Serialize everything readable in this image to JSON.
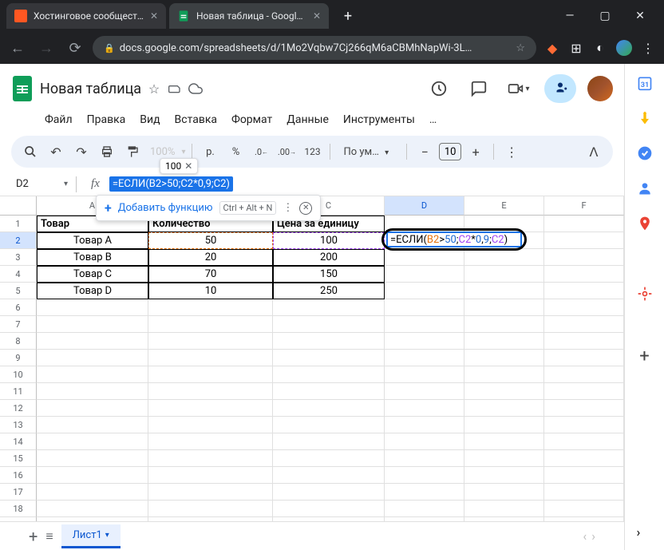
{
  "browser": {
    "tabs": [
      {
        "favicon_color": "#ff0000",
        "title": "Хостинговое сообщество «Tim"
      },
      {
        "favicon_color": "#0f9d58",
        "title": "Новая таблица - Google Табли"
      }
    ],
    "url": "docs.google.com/spreadsheets/d/1Mo2Vqbw7Cj266qM6aCBMhNapWi-3L…"
  },
  "doc": {
    "title": "Новая таблица",
    "menus": [
      "Файл",
      "Правка",
      "Вид",
      "Вставка",
      "Формат",
      "Данные",
      "Инструменты",
      "…"
    ]
  },
  "toolbar": {
    "zoom": "100%",
    "currency": "р.",
    "percent": "%",
    "dec_dec": ".0",
    "inc_dec": ".00",
    "fmt123": "123",
    "font": "По ум…",
    "font_size": "10",
    "zoom_tooltip": "100"
  },
  "namebox": {
    "cell_ref": "D2",
    "formula": "=ЕСЛИ(B2>50;C2*0,9;C2)"
  },
  "formula_help": {
    "label": "Добавить функцию",
    "shortcut": "Ctrl + Alt + N"
  },
  "columns": [
    "A",
    "B",
    "C",
    "D",
    "E",
    "F"
  ],
  "rows": 19,
  "headers": {
    "A": "Товар",
    "B": "Количество",
    "C": "Цена за единицу"
  },
  "data": [
    {
      "A": "Товар A",
      "B": "50",
      "C": "100"
    },
    {
      "A": "Товар B",
      "B": "20",
      "C": "200"
    },
    {
      "A": "Товар C",
      "B": "70",
      "C": "150"
    },
    {
      "A": "Товар D",
      "B": "10",
      "C": "250"
    }
  ],
  "active_cell": {
    "formula_parts": [
      "=",
      "ЕСЛИ",
      "(",
      "B2",
      ">",
      "50",
      ";",
      "C2",
      "*",
      "0",
      ",",
      "9",
      ";",
      "C2",
      ")"
    ]
  },
  "sheet_tab": "Лист1"
}
